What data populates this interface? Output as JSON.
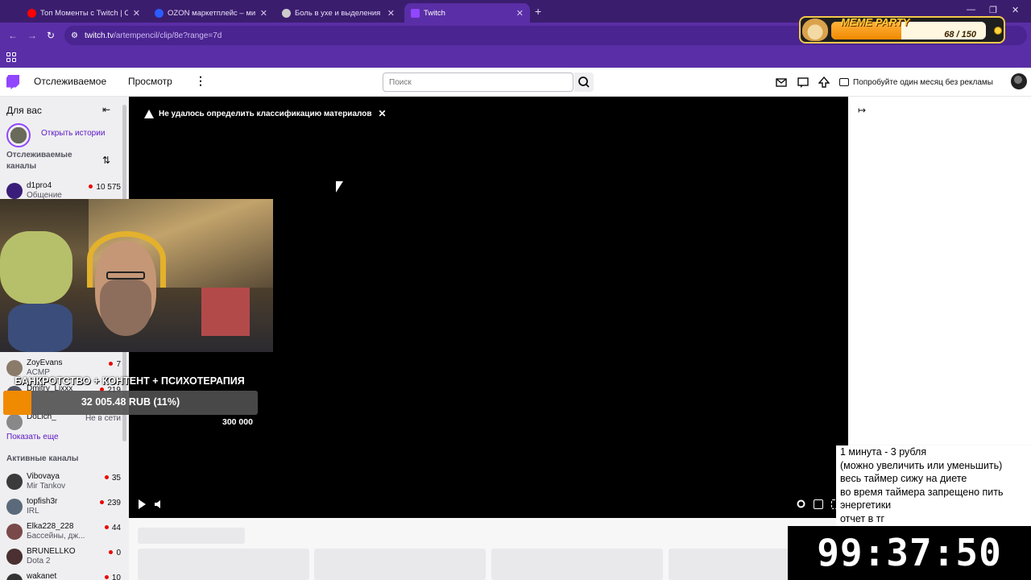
{
  "browser": {
    "tabs": [
      {
        "title": "Топ Моменты с Twitch | Снова",
        "favicon_color": "#ff0000"
      },
      {
        "title": "OZON маркетплейс – миллионы",
        "favicon_color": "#2a5cff"
      },
      {
        "title": "Боль в ухе и выделения",
        "favicon_color": "#cccccc"
      },
      {
        "title": "Twitch",
        "favicon_color": "#9146ff"
      }
    ],
    "url_host": "twitch.tv",
    "url_path": "/artempencil/clip/8e?range=7d"
  },
  "meme_party": {
    "title": "MEME PARTY",
    "count": "68 / 150",
    "progress": 0.453
  },
  "twitch_nav": {
    "following": "Отслеживаемое",
    "browse": "Просмотр",
    "search_placeholder": "Поиск",
    "promo": "Попробуйте один месяц без рекламы"
  },
  "sidebar": {
    "heading": "Для вас",
    "stories": "Открыть истории",
    "followed_heading": "Отслеживаемые каналы",
    "followed": [
      {
        "name": "d1pro4",
        "category": "Общение",
        "viewers": "10 575",
        "live": true
      },
      {
        "name": "ZoyEvans",
        "category": "ACMP",
        "viewers": "7",
        "live": true
      },
      {
        "name": "Dmitry_Lixxx",
        "category": "",
        "viewers": "219",
        "live": true
      },
      {
        "name": "DoLich_",
        "category": "",
        "viewers": "Не в сети",
        "live": false
      }
    ],
    "show_more": "Показать еще",
    "active_heading": "Активные каналы",
    "active": [
      {
        "name": "Vibovaya",
        "category": "Mir Tankov",
        "viewers": "35"
      },
      {
        "name": "topfish3r",
        "category": "IRL",
        "viewers": "239"
      },
      {
        "name": "Elka228_228",
        "category": "Бассейны, дж...",
        "viewers": "44"
      },
      {
        "name": "BRUNELLKO",
        "category": "Dota 2",
        "viewers": "0"
      },
      {
        "name": "wakanet",
        "category": "",
        "viewers": "10"
      }
    ]
  },
  "player": {
    "warning": "Не удалось определить классификацию материалов"
  },
  "stream_overlay": {
    "title": "БАНКРОТСТВО + КОНТЕНТ + ПСИХОТЕРАПИЯ",
    "raised": "32 005.48 RUB (11%)",
    "progress": 0.11,
    "goal": "300 000"
  },
  "timer_overlay": {
    "rules": [
      "1 минута - 3 рубля",
      "(можно увеличить или уменьшить)",
      "весь таймер сижу на диете",
      "во время таймера запрещено пить",
      "энергетики",
      "отчет в тг"
    ],
    "time": "99:37:50"
  }
}
